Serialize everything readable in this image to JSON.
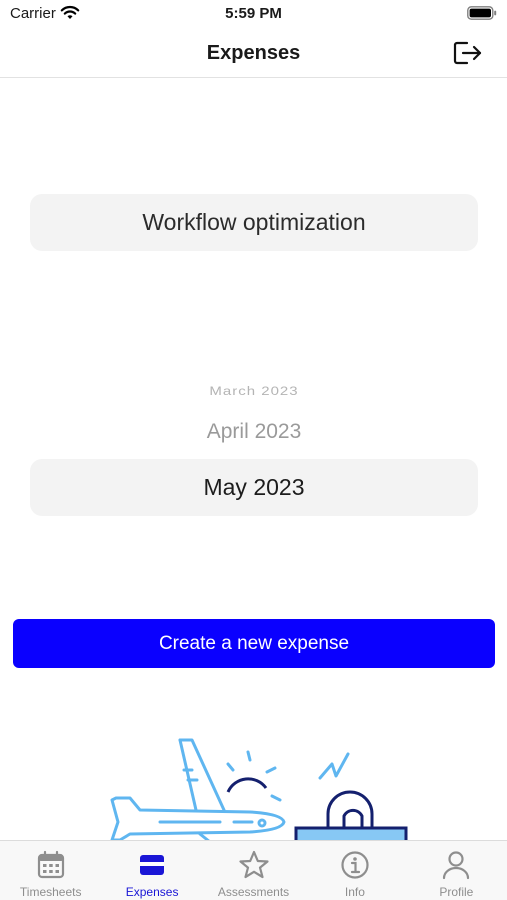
{
  "status_bar": {
    "carrier": "Carrier",
    "time": "5:59 PM"
  },
  "header": {
    "title": "Expenses",
    "logout_icon": "logout-icon"
  },
  "project": {
    "selected": "Workflow optimization"
  },
  "month_picker": {
    "items": [
      "March 2023",
      "April 2023",
      "May 2023"
    ],
    "selected": "May 2023"
  },
  "actions": {
    "create_label": "Create a new expense"
  },
  "tabs": [
    {
      "label": "Timesheets",
      "icon": "calendar-icon",
      "active": false
    },
    {
      "label": "Expenses",
      "icon": "card-icon",
      "active": true
    },
    {
      "label": "Assessments",
      "icon": "star-icon",
      "active": false
    },
    {
      "label": "Info",
      "icon": "info-icon",
      "active": false
    },
    {
      "label": "Profile",
      "icon": "person-icon",
      "active": false
    }
  ],
  "colors": {
    "accent": "#0a00ff",
    "tab_active": "#1a16d6",
    "tab_inactive": "#8e8e8e",
    "illustration_light": "#5fb6f0",
    "illustration_dark": "#14206e"
  }
}
